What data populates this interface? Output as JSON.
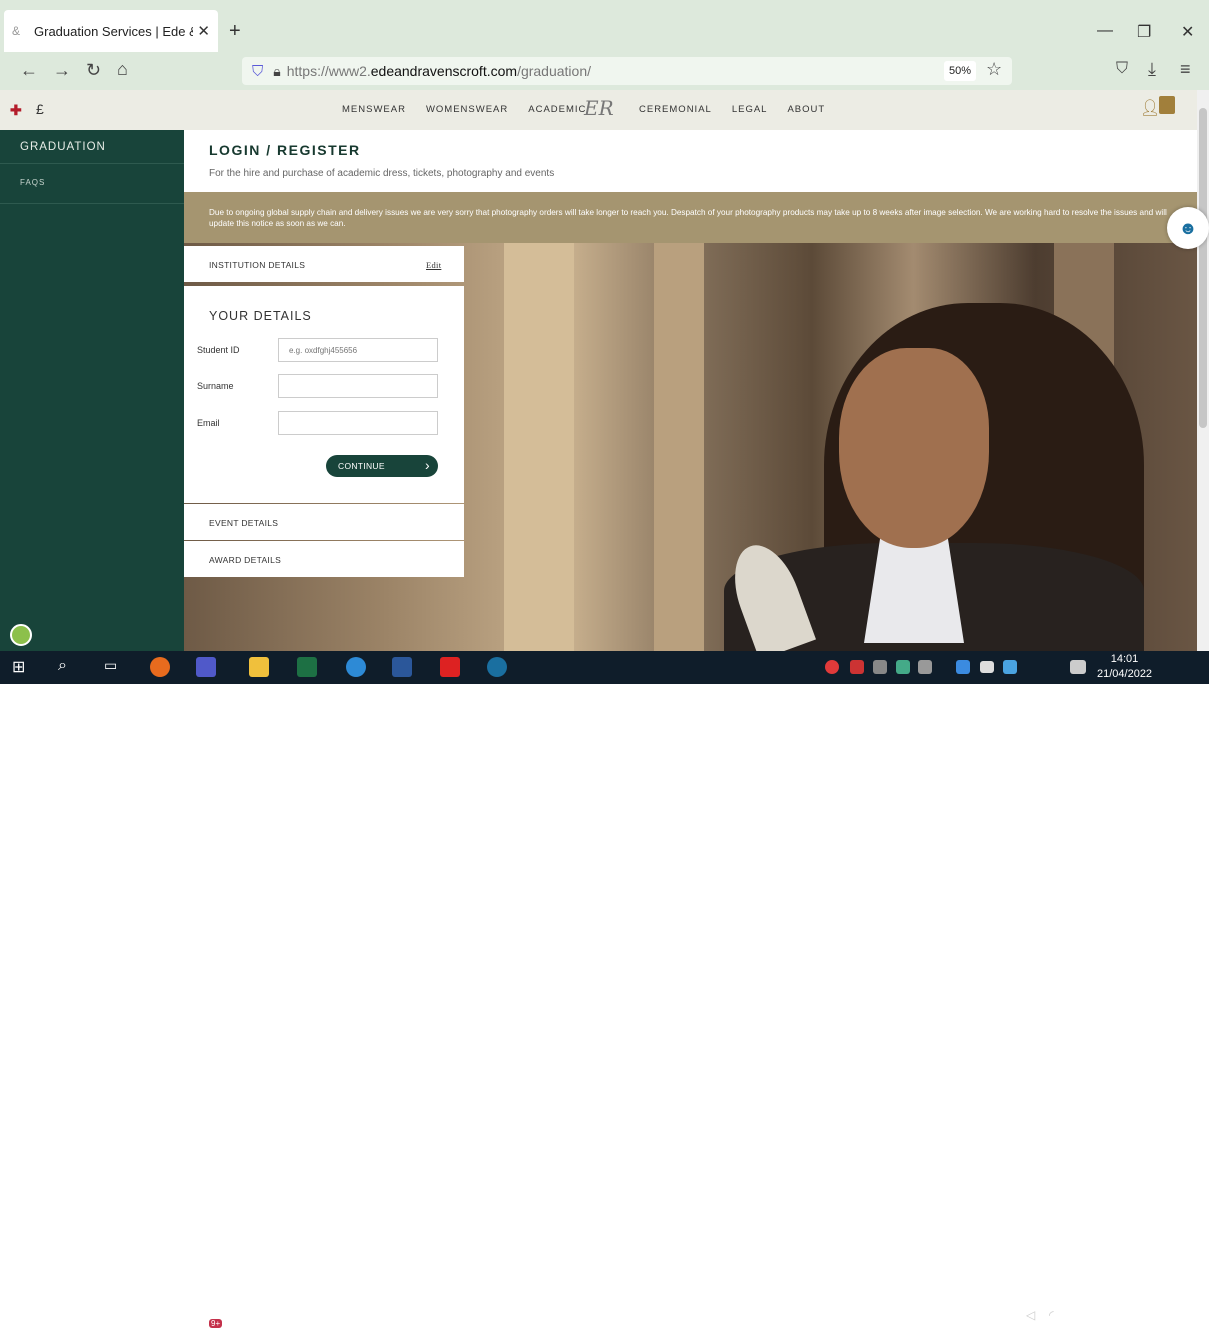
{
  "browser": {
    "tab_title": "Graduation Services | Ede & Rav",
    "url_prefix": "https://www2.",
    "url_domain": "edeandravenscroft.com",
    "url_path": "/graduation/",
    "zoom": "50%"
  },
  "site": {
    "currency": "£",
    "logo": "ER",
    "nav_left": [
      "MENSWEAR",
      "WOMENSWEAR",
      "ACADEMIC"
    ],
    "nav_right": [
      "CEREMONIAL",
      "LEGAL",
      "ABOUT"
    ]
  },
  "sidebar": {
    "items": [
      {
        "label": "GRADUATION"
      },
      {
        "label": "FAQS"
      }
    ]
  },
  "page": {
    "title": "LOGIN / REGISTER",
    "subtitle": "For the hire and purchase of academic dress, tickets, photography and events",
    "notice": "Due to ongoing global supply chain and delivery issues we are very sorry that photography orders will take longer to reach you. Despatch of your photography products may take up to 8 weeks after image selection. We are working hard to resolve the issues and will update this notice as soon as we can."
  },
  "form": {
    "institution_label": "INSTITUTION DETAILS",
    "edit_label": "Edit",
    "heading": "YOUR DETAILS",
    "student_id_label": "Student ID",
    "student_id_placeholder": "e.g. oxdfghj455656",
    "surname_label": "Surname",
    "email_label": "Email",
    "continue_label": "CONTINUE",
    "event_label": "EVENT DETAILS",
    "award_label": "AWARD DETAILS"
  },
  "taskbar": {
    "time": "14:01",
    "date": "21/04/2022",
    "teams_badge": "9+"
  }
}
